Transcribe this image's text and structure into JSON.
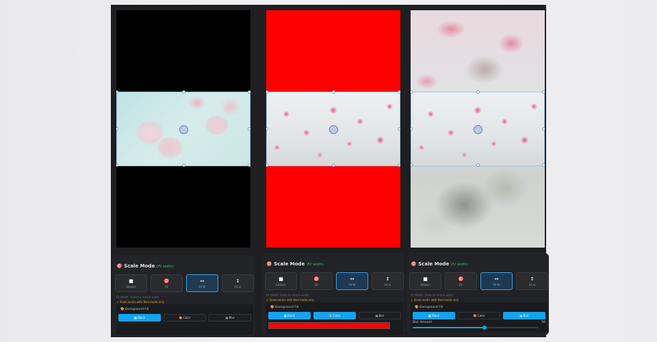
{
  "panels": [
    {
      "id": "black",
      "scale_mode_title": "Scale Mode",
      "scale_mode_hint": "(Fit width)",
      "modes": [
        {
          "label": "Stretch",
          "icon": "■"
        },
        {
          "label": "Fit",
          "icon": "🎯"
        },
        {
          "label": "Fit W",
          "icon": "↔"
        },
        {
          "label": "Fit H",
          "icon": "↕"
        }
      ],
      "active_mode": 2,
      "note": "Fit Width: Scale to match width",
      "warning": "⚠ Scale works with Ned mode only",
      "fill_title": "Background Fill",
      "fill_buttons": [
        "Black",
        "Color",
        "Blur"
      ],
      "active_fill": 0
    },
    {
      "id": "color",
      "scale_mode_title": "Scale Mode",
      "scale_mode_hint": "(Fit width)",
      "modes": [
        {
          "label": "Stretch",
          "icon": "■"
        },
        {
          "label": "Fit",
          "icon": "🎯"
        },
        {
          "label": "Fit W",
          "icon": "↔"
        },
        {
          "label": "Fit H",
          "icon": "↕"
        }
      ],
      "active_mode": 2,
      "note": "Fit Width: Scale to match width",
      "warning": "⚠ Scale works with Ned mode only",
      "fill_title": "Background Fill",
      "fill_buttons": [
        "Black",
        "Color",
        "Blur"
      ],
      "active_fill": 1,
      "fill_color": "#ff0000"
    },
    {
      "id": "blur",
      "scale_mode_title": "Scale Mode",
      "scale_mode_hint": "(Fit width)",
      "modes": [
        {
          "label": "Stretch",
          "icon": "■"
        },
        {
          "label": "Fit",
          "icon": "🎯"
        },
        {
          "label": "Fit W",
          "icon": "↔"
        },
        {
          "label": "Fit H",
          "icon": "↕"
        }
      ],
      "active_mode": 2,
      "note": "Fit Width: Scale to match width",
      "warning": "⚠ Scale works with Ned mode only",
      "fill_title": "Background Fill",
      "fill_buttons": [
        "Black",
        "Color",
        "Blur"
      ],
      "active_fill": 2,
      "blur_label": "Blur Amount",
      "blur_value": "50",
      "blur_fraction": 0.57
    }
  ],
  "colors": {
    "accent": "#12a4f0",
    "warning": "#e0a33a",
    "hint": "#22c55e",
    "red_fill": "#ff0000"
  }
}
